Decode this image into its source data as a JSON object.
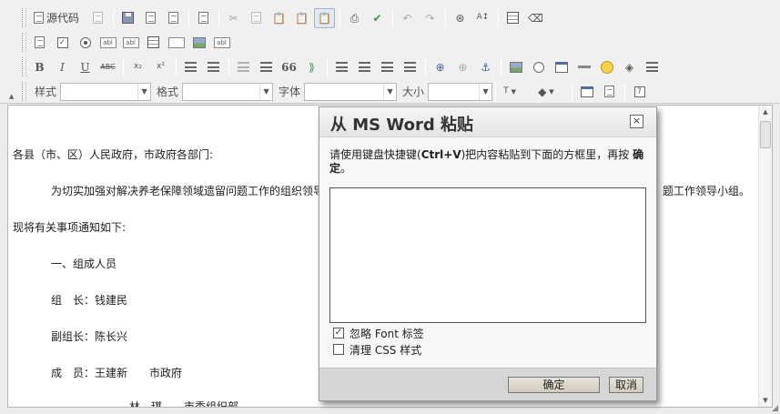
{
  "toolbar": {
    "source_label": "源代码",
    "style_label": "样式",
    "style_value": "",
    "format_label": "格式",
    "format_value": "",
    "font_label": "字体",
    "font_value": "",
    "size_label": "大小",
    "size_value": "",
    "bold": "B",
    "italic": "I",
    "underline": "U",
    "strike": "ABC",
    "subscript": "x₂",
    "superscript": "x²",
    "blockquote": "66",
    "help": "?"
  },
  "document": {
    "paragraphs": [
      "各县（市、区）人民政府，市政府各部门:",
      "为切实加强对解决养老保障领域遗留问题工作的组织领导",
      "题工作领导小组。",
      "现将有关事项通知如下:",
      "一、组成人员",
      "组　长：钱建民",
      "副组长：陈长兴",
      "成　员：王建新　　市政府",
      "林　琪　　市委组织部"
    ]
  },
  "dialog": {
    "title": "从 MS Word 粘贴",
    "close_symbol": "×",
    "instruction_prefix": "请使用键盘快捷键(",
    "instruction_shortcut": "Ctrl+V",
    "instruction_middle": ")把内容粘贴到下面的方框里，再按",
    "instruction_confirm": "确定",
    "instruction_suffix": "。",
    "paste_value": "",
    "ignore_font_label": "忽略 Font 标签",
    "ignore_font_checked": true,
    "clean_css_label": "清理 CSS 样式",
    "clean_css_checked": false,
    "ok_label": "确定",
    "cancel_label": "取消"
  },
  "colors": {
    "toolbar_bg": "#f0f0f0",
    "dialog_footer": "#d6d6d6",
    "button_face": "#d3ccbd"
  }
}
